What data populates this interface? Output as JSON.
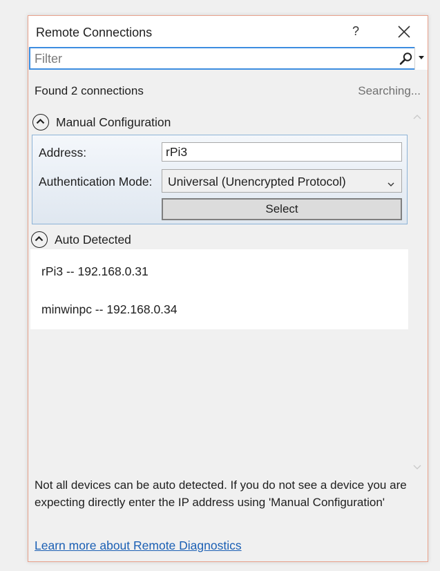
{
  "window": {
    "title": "Remote Connections",
    "help_label": "?"
  },
  "filter": {
    "placeholder": "Filter",
    "value": ""
  },
  "status": {
    "found": "Found 2 connections",
    "searching": "Searching..."
  },
  "manual": {
    "header": "Manual Configuration",
    "address_label": "Address:",
    "address_value": "rPi3",
    "auth_label": "Authentication Mode:",
    "auth_value": "Universal (Unencrypted Protocol)",
    "select_label": "Select"
  },
  "auto": {
    "header": "Auto Detected",
    "items": [
      {
        "label": "rPi3 -- 192.168.0.31"
      },
      {
        "label": "minwinpc -- 192.168.0.34"
      }
    ]
  },
  "footer": {
    "note": "Not all devices can be auto detected. If you do not see a device you are expecting directly enter the IP address using 'Manual Configuration'",
    "link": "Learn more about Remote Diagnostics"
  },
  "icons": {
    "help": "help-icon",
    "close": "close-icon",
    "search": "search-icon",
    "dropdown": "dropdown-arrow-icon",
    "collapse": "collapse-chevron-icon",
    "scroll_up": "scroll-up-icon",
    "scroll_down": "scroll-down-icon"
  },
  "colors": {
    "accent": "#3c8de0",
    "window_border": "#e8a08a",
    "link": "#1a5fb4",
    "panel_border": "#8cb2d6"
  }
}
